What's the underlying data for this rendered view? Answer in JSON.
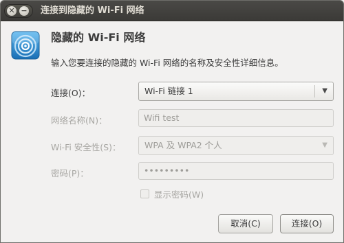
{
  "window": {
    "title": "连接到隐藏的 Wi-Fi 网络",
    "close_symbol": "✕",
    "minimize_symbol": "−"
  },
  "dialog": {
    "icon": "wifi-icon",
    "heading": "隐藏的 Wi-Fi 网络",
    "description": "输入您要连接的隐藏的 Wi-Fi 网络的名称及安全性详细信息。"
  },
  "form": {
    "connection": {
      "label": "连接(O)：",
      "value": "Wi-Fi 链接 1"
    },
    "network_name": {
      "label": "网络名称(N)：",
      "value": "Wifi test"
    },
    "security": {
      "label": "Wi-Fi 安全性(S)：",
      "value": "WPA 及 WPA2 个人"
    },
    "password": {
      "label": "密码(P)：",
      "value": "•••••••••"
    },
    "show_password": {
      "label": "显示密码(W)",
      "checked": false
    }
  },
  "buttons": {
    "cancel": "取消(C)",
    "connect": "连接(O)"
  },
  "colors": {
    "titlebar": "#3c3b37",
    "background": "#f2f1f0",
    "icon_blue": "#2a8fd6"
  }
}
